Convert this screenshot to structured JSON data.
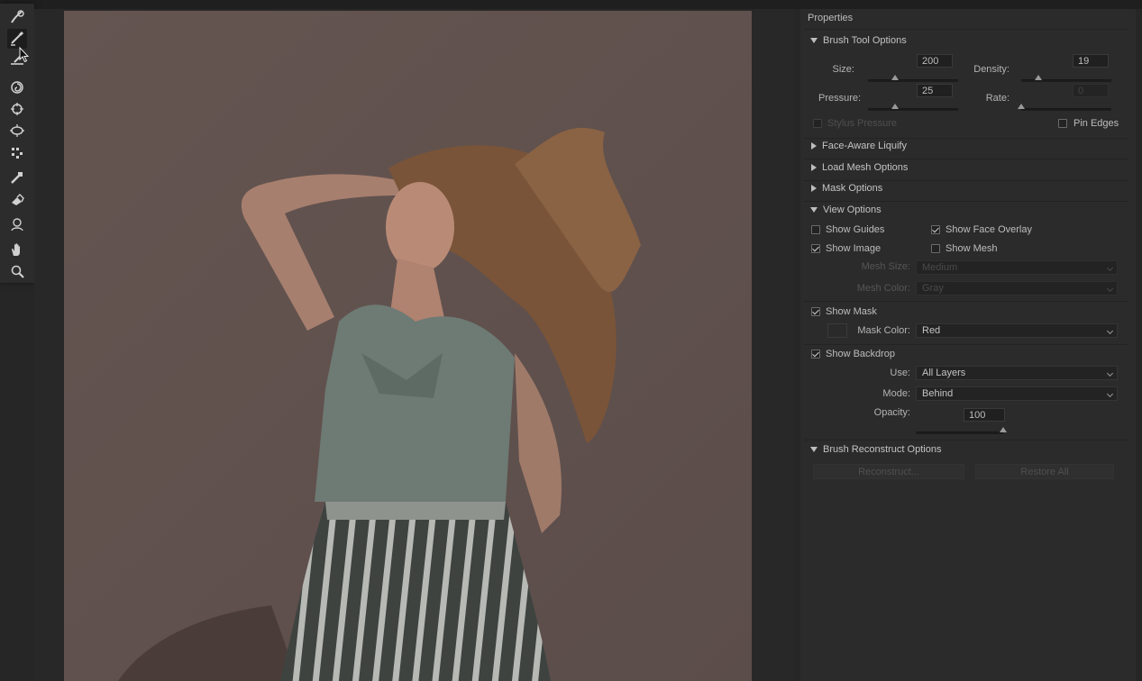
{
  "toolbar": {
    "tools": [
      {
        "name": "forward-warp-tool",
        "icon": "forward-warp-icon"
      },
      {
        "name": "reconstruct-tool",
        "icon": "reconstruct-icon",
        "active": true
      },
      {
        "name": "smooth-tool",
        "icon": "smooth-icon"
      },
      {
        "name": "twirl-clockwise-tool",
        "icon": "twirl-icon"
      },
      {
        "name": "pucker-tool",
        "icon": "pucker-icon"
      },
      {
        "name": "bloat-tool",
        "icon": "bloat-icon"
      },
      {
        "name": "push-left-tool",
        "icon": "push-left-icon"
      },
      {
        "name": "freeze-mask-tool",
        "icon": "freeze-mask-icon"
      },
      {
        "name": "thaw-mask-tool",
        "icon": "thaw-mask-icon"
      },
      {
        "name": "face-tool",
        "icon": "face-icon"
      },
      {
        "name": "hand-tool",
        "icon": "hand-icon"
      },
      {
        "name": "zoom-tool",
        "icon": "zoom-icon"
      }
    ]
  },
  "panel": {
    "title": "Properties",
    "brush_tool_options": {
      "header": "Brush Tool Options",
      "size_label": "Size:",
      "size_value": "200",
      "size_fraction": 0.3,
      "density_label": "Density:",
      "density_value": "19",
      "density_fraction": 0.19,
      "pressure_label": "Pressure:",
      "pressure_value": "25",
      "pressure_fraction": 0.3,
      "rate_label": "Rate:",
      "rate_value": "0",
      "rate_fraction": 0.0,
      "stylus_pressure_label": "Stylus Pressure",
      "pin_edges_label": "Pin Edges"
    },
    "face_aware_liquify": {
      "header": "Face-Aware Liquify"
    },
    "load_mesh_options": {
      "header": "Load Mesh Options"
    },
    "mask_options": {
      "header": "Mask Options"
    },
    "view_options": {
      "header": "View Options",
      "show_guides_label": "Show Guides",
      "show_face_overlay_label": "Show Face Overlay",
      "show_image_label": "Show Image",
      "show_mesh_label": "Show Mesh",
      "mesh_size_label": "Mesh Size:",
      "mesh_size_value": "Medium",
      "mesh_color_label": "Mesh Color:",
      "mesh_color_value": "Gray",
      "show_mask_label": "Show Mask",
      "mask_color_label": "Mask Color:",
      "mask_color_value": "Red",
      "show_backdrop_label": "Show Backdrop",
      "use_label": "Use:",
      "use_value": "All Layers",
      "mode_label": "Mode:",
      "mode_value": "Behind",
      "opacity_label": "Opacity:",
      "opacity_value": "100",
      "opacity_fraction": 1.0
    },
    "brush_reconstruct_options": {
      "header": "Brush Reconstruct Options",
      "reconstruct_label": "Reconstruct...",
      "restore_all_label": "Restore All"
    }
  },
  "colors": {
    "panel_bg": "#2b2b2b",
    "canvas_bg": "#282828",
    "photo_wall": "#5f514e"
  }
}
